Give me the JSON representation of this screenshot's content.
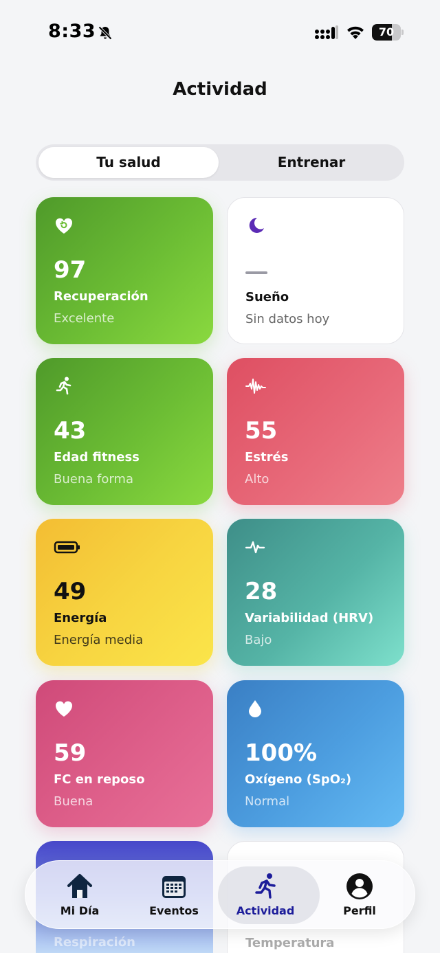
{
  "status": {
    "time": "8:33",
    "battery": "70",
    "battery_level": 0.7
  },
  "title": "Actividad",
  "segments": [
    {
      "label": "Tu salud",
      "active": true
    },
    {
      "label": "Entrenar",
      "active": false
    }
  ],
  "cards": [
    {
      "value": "97",
      "label": "Recuperación",
      "sub": "Excelente",
      "icon": "heart-refresh-icon",
      "color": "#6cbd34"
    },
    {
      "value": "—",
      "label": "Sueño",
      "sub": "Sin datos hoy",
      "icon": "moon-icon",
      "color": "#5b2bb5"
    },
    {
      "value": "43",
      "label": "Edad fitness",
      "sub": "Buena forma",
      "icon": "running-icon",
      "color": "#6cbd34"
    },
    {
      "value": "55",
      "label": "Estrés",
      "sub": "Alto",
      "icon": "waveform-icon",
      "color": "#e86a7a"
    },
    {
      "value": "49",
      "label": "Energía",
      "sub": "Energía media",
      "icon": "battery-icon",
      "color": "#f7d440"
    },
    {
      "value": "28",
      "label": "Variabilidad (HRV)",
      "sub": "Bajo",
      "icon": "pulse-icon",
      "color": "#55b4a6"
    },
    {
      "value": "59",
      "label": "FC en reposo",
      "sub": "Buena",
      "icon": "heart-icon",
      "color": "#de5f8a"
    },
    {
      "value": "100%",
      "label": "Oxígeno (SpO₂)",
      "sub": "Normal",
      "icon": "drop-icon",
      "color": "#4d9ee0"
    },
    {
      "label": "Respiración",
      "icon": "lungs-icon",
      "color": "#4747c9"
    },
    {
      "label": "Temperatura",
      "icon": "thermometer-icon",
      "color": "#ffffff"
    }
  ],
  "tabbar": [
    {
      "label": "Mi Día",
      "icon": "home-icon",
      "active": false
    },
    {
      "label": "Eventos",
      "icon": "calendar-icon",
      "active": false
    },
    {
      "label": "Actividad",
      "icon": "running-icon",
      "active": true
    },
    {
      "label": "Perfil",
      "icon": "person-icon",
      "active": false
    }
  ]
}
